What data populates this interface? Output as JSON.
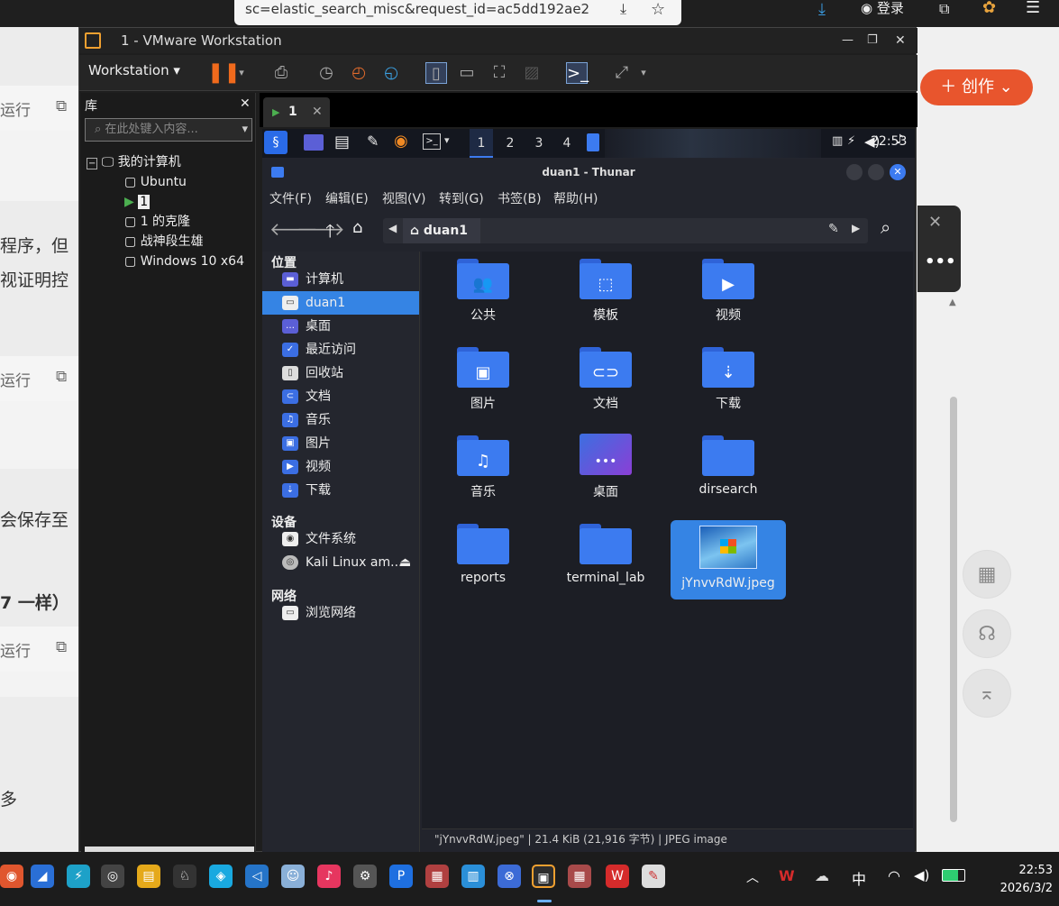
{
  "browser": {
    "url_fragment": "sc=elastic_search_misc&request_id=ac5dd192ae2",
    "login_label": "登录",
    "create_label": "创作",
    "article_fragments": [
      "程序，但",
      "视证明控",
      "会保存至",
      "7 一样）",
      "多"
    ],
    "run_label": "运行"
  },
  "vmware": {
    "title": "1 - VMware Workstation",
    "workstation_menu": "Workstation",
    "library_title": "库",
    "search_placeholder": "在此处键入内容...",
    "tree_root": "我的计算机",
    "vms": [
      "Ubuntu",
      "1",
      "1 的克隆",
      "战神段生雄",
      "Windows 10 x64"
    ],
    "active_tab": "1"
  },
  "kali": {
    "workspaces": [
      "1",
      "2",
      "3",
      "4"
    ],
    "time": "22:53"
  },
  "thunar": {
    "title": "duan1 - Thunar",
    "menu": [
      "文件(F)",
      "编辑(E)",
      "视图(V)",
      "转到(G)",
      "书签(B)",
      "帮助(H)"
    ],
    "path": "duan1",
    "sections": {
      "places": "位置",
      "devices": "设备",
      "network": "网络"
    },
    "places": [
      {
        "label": "计算机",
        "icon": "computer-icon"
      },
      {
        "label": "duan1",
        "icon": "home-icon"
      },
      {
        "label": "桌面",
        "icon": "desktop-icon"
      },
      {
        "label": "最近访问",
        "icon": "recent-icon"
      },
      {
        "label": "回收站",
        "icon": "trash-icon"
      },
      {
        "label": "文档",
        "icon": "documents-icon"
      },
      {
        "label": "音乐",
        "icon": "music-icon"
      },
      {
        "label": "图片",
        "icon": "pictures-icon"
      },
      {
        "label": "视频",
        "icon": "videos-icon"
      },
      {
        "label": "下载",
        "icon": "downloads-icon"
      }
    ],
    "devices": [
      "文件系统",
      "Kali Linux am..."
    ],
    "network": [
      "浏览网络"
    ],
    "files": [
      {
        "name": "公共",
        "glyph": "👥"
      },
      {
        "name": "模板",
        "glyph": "⬚"
      },
      {
        "name": "视频",
        "glyph": "▶"
      },
      {
        "name": "图片",
        "glyph": "▣"
      },
      {
        "name": "文档",
        "glyph": "⊂⊃"
      },
      {
        "name": "下载",
        "glyph": "⇣"
      },
      {
        "name": "音乐",
        "glyph": "♫"
      },
      {
        "name": "桌面",
        "glyph": "…"
      },
      {
        "name": "dirsearch",
        "glyph": ""
      },
      {
        "name": "reports",
        "glyph": ""
      },
      {
        "name": "terminal_lab",
        "glyph": ""
      },
      {
        "name": "jYnvvRdW.jpeg",
        "glyph": ""
      }
    ],
    "status": "\"jYnvvRdW.jpeg\" | 21.4 KiB (21,916 字节) | JPEG image"
  },
  "taskbar": {
    "ime": "中",
    "time": "22:53",
    "date": "2026/3/2"
  },
  "colors": {
    "accent_blue": "#3c7bf0",
    "selected": "#3584e4",
    "create_orange": "#e8552d"
  }
}
